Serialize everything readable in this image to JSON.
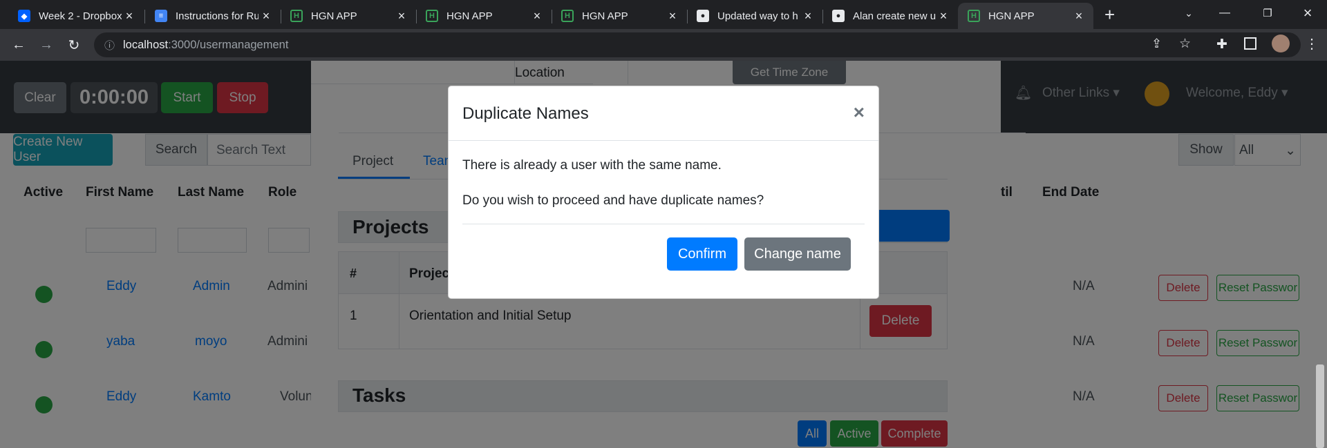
{
  "browser": {
    "tabs": [
      {
        "title": "Week 2 - Dropbox",
        "favicon": "dropbox-icon"
      },
      {
        "title": "Instructions for Ru",
        "favicon": "docs-icon"
      },
      {
        "title": "HGN APP",
        "favicon": "hgn-icon"
      },
      {
        "title": "HGN APP",
        "favicon": "hgn-icon"
      },
      {
        "title": "HGN APP",
        "favicon": "hgn-icon"
      },
      {
        "title": "Updated way to h",
        "favicon": "github-icon"
      },
      {
        "title": "Alan create new u",
        "favicon": "github-icon"
      },
      {
        "title": "HGN APP",
        "favicon": "hgn-icon"
      }
    ],
    "active_tab_index": 7,
    "url_host": "localhost",
    "url_path": ":3000/usermanagement"
  },
  "app": {
    "timer": {
      "clear": "Clear",
      "time": "0:00:00",
      "start": "Start",
      "stop": "Stop"
    },
    "nav": {
      "other_links": "Other Links",
      "welcome": "Welcome, Eddy"
    },
    "create_user": "Create New User",
    "search_label": "Search",
    "search_placeholder": "Search Text",
    "show_label": "Show",
    "show_value": "All",
    "columns": {
      "active": "Active",
      "first": "First Name",
      "last": "Last Name",
      "role": "Role",
      "until": "til",
      "end": "End Date"
    },
    "rows": [
      {
        "first": "Eddy",
        "last": "Admin",
        "role": "Admini",
        "end": "N/A"
      },
      {
        "first": "yaba",
        "last": "moyo",
        "role": "Admini",
        "end": "N/A"
      },
      {
        "first": "Eddy",
        "last": "Kamto",
        "role": "Volun",
        "end": "N/A"
      }
    ],
    "row_delete": "Delete",
    "row_reset": "Reset Passwor"
  },
  "profile": {
    "location_label": "Location",
    "get_time_zone": "Get Time Zone",
    "tab_project": "Project",
    "tab_team": "Tean",
    "projects_heading": "Projects",
    "col_num": "#",
    "col_project": "Projec",
    "project_row": {
      "num": "1",
      "name": "Orientation and Initial Setup",
      "delete": "Delete"
    },
    "tasks_heading": "Tasks",
    "filter_all": "All",
    "filter_active": "Active",
    "filter_complete": "Complete"
  },
  "dialog": {
    "title": "Duplicate Names",
    "close": "×",
    "line1": "There is already a user with the same name.",
    "line2": "Do you wish to proceed and have duplicate names?",
    "confirm": "Confirm",
    "change_name": "Change name"
  },
  "colors": {
    "primary": "#007bff",
    "secondary": "#6c757d",
    "success": "#28a745",
    "danger": "#dc3545"
  }
}
